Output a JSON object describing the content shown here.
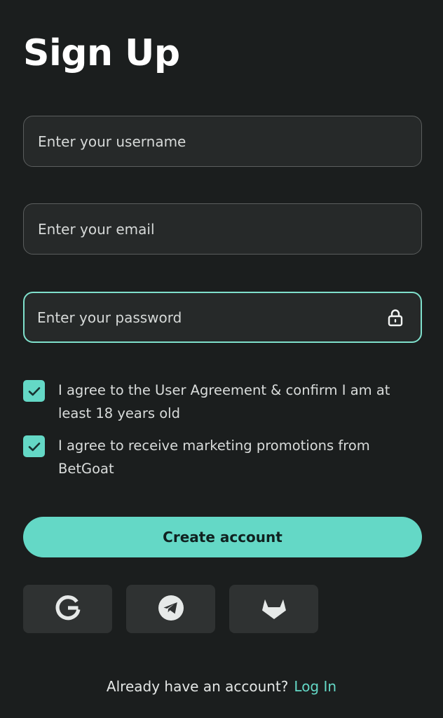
{
  "page": {
    "title": "Sign Up"
  },
  "form": {
    "username_placeholder": "Enter your username",
    "email_placeholder": "Enter your email",
    "password_placeholder": "Enter your password"
  },
  "checkboxes": [
    {
      "label": "I agree to the User Agreement & confirm I am at least 18 years old",
      "checked": true
    },
    {
      "label": "I agree to receive marketing promotions from BetGoat",
      "checked": true
    }
  ],
  "actions": {
    "create_label": "Create account"
  },
  "social": {
    "providers": [
      "google-icon",
      "telegram-icon",
      "gitlab-icon"
    ]
  },
  "footer": {
    "prompt": "Already have an account?",
    "login_label": "Log In"
  },
  "colors": {
    "background": "#1b1e1e",
    "accent": "#64d8c6",
    "field_bg": "#262929",
    "social_bg": "#2f3232"
  }
}
